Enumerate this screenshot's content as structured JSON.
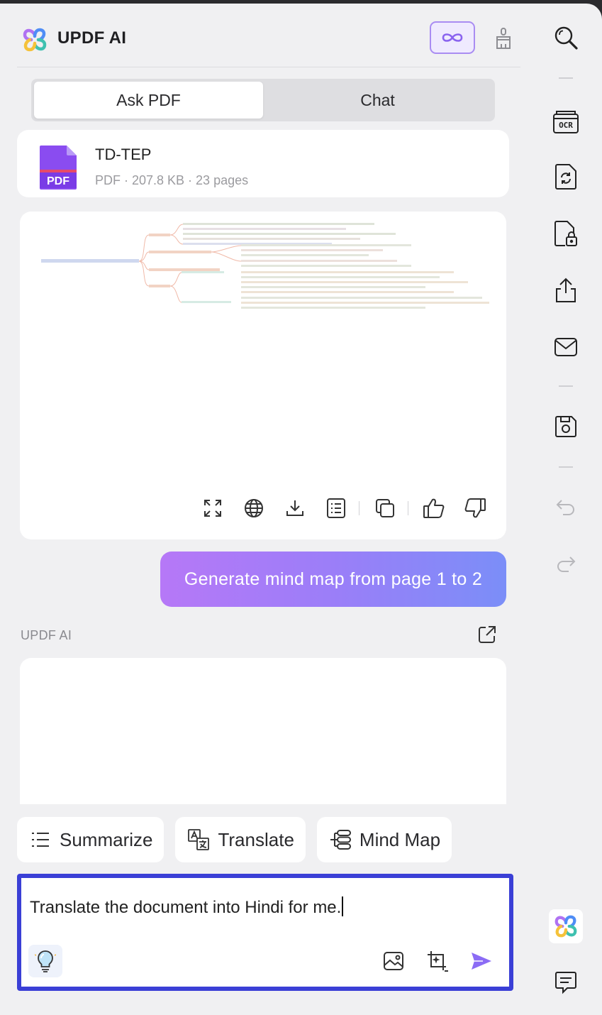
{
  "app": {
    "title": "UPDF AI"
  },
  "tabs": [
    {
      "label": "Ask PDF",
      "active": true
    },
    {
      "label": "Chat",
      "active": false
    }
  ],
  "file": {
    "name": "TD-TEP",
    "meta": "PDF · 207.8 KB · 23 pages",
    "icon_badge": "PDF"
  },
  "mindmap_toolbar": [
    "fullscreen-icon",
    "globe-icon",
    "download-icon",
    "outline-icon",
    "copy-icon",
    "thumbs-up-icon",
    "thumbs-down-icon"
  ],
  "user_message": "Generate mind map from page 1 to 2",
  "ai_label": "UPDF AI",
  "quick_actions": [
    {
      "label": "Summarize",
      "icon": "list-icon"
    },
    {
      "label": "Translate",
      "icon": "translate-icon"
    },
    {
      "label": "Mind Map",
      "icon": "mind-map-icon"
    }
  ],
  "input": {
    "value": "Translate the document into Hindi for me."
  },
  "sidebar": [
    "search-icon",
    "ocr-icon",
    "convert-icon",
    "protect-icon",
    "share-icon",
    "email-icon",
    "save-icon",
    "undo-icon",
    "redo-icon",
    "updf-ai-icon",
    "comment-icon"
  ],
  "colors": {
    "accent_border": "#3a3fd6",
    "bubble_gradient_start": "#b678f7",
    "bubble_gradient_end": "#7b8ef8",
    "pdf_icon": "#8a4cf0",
    "send": "#8b6cf5"
  }
}
